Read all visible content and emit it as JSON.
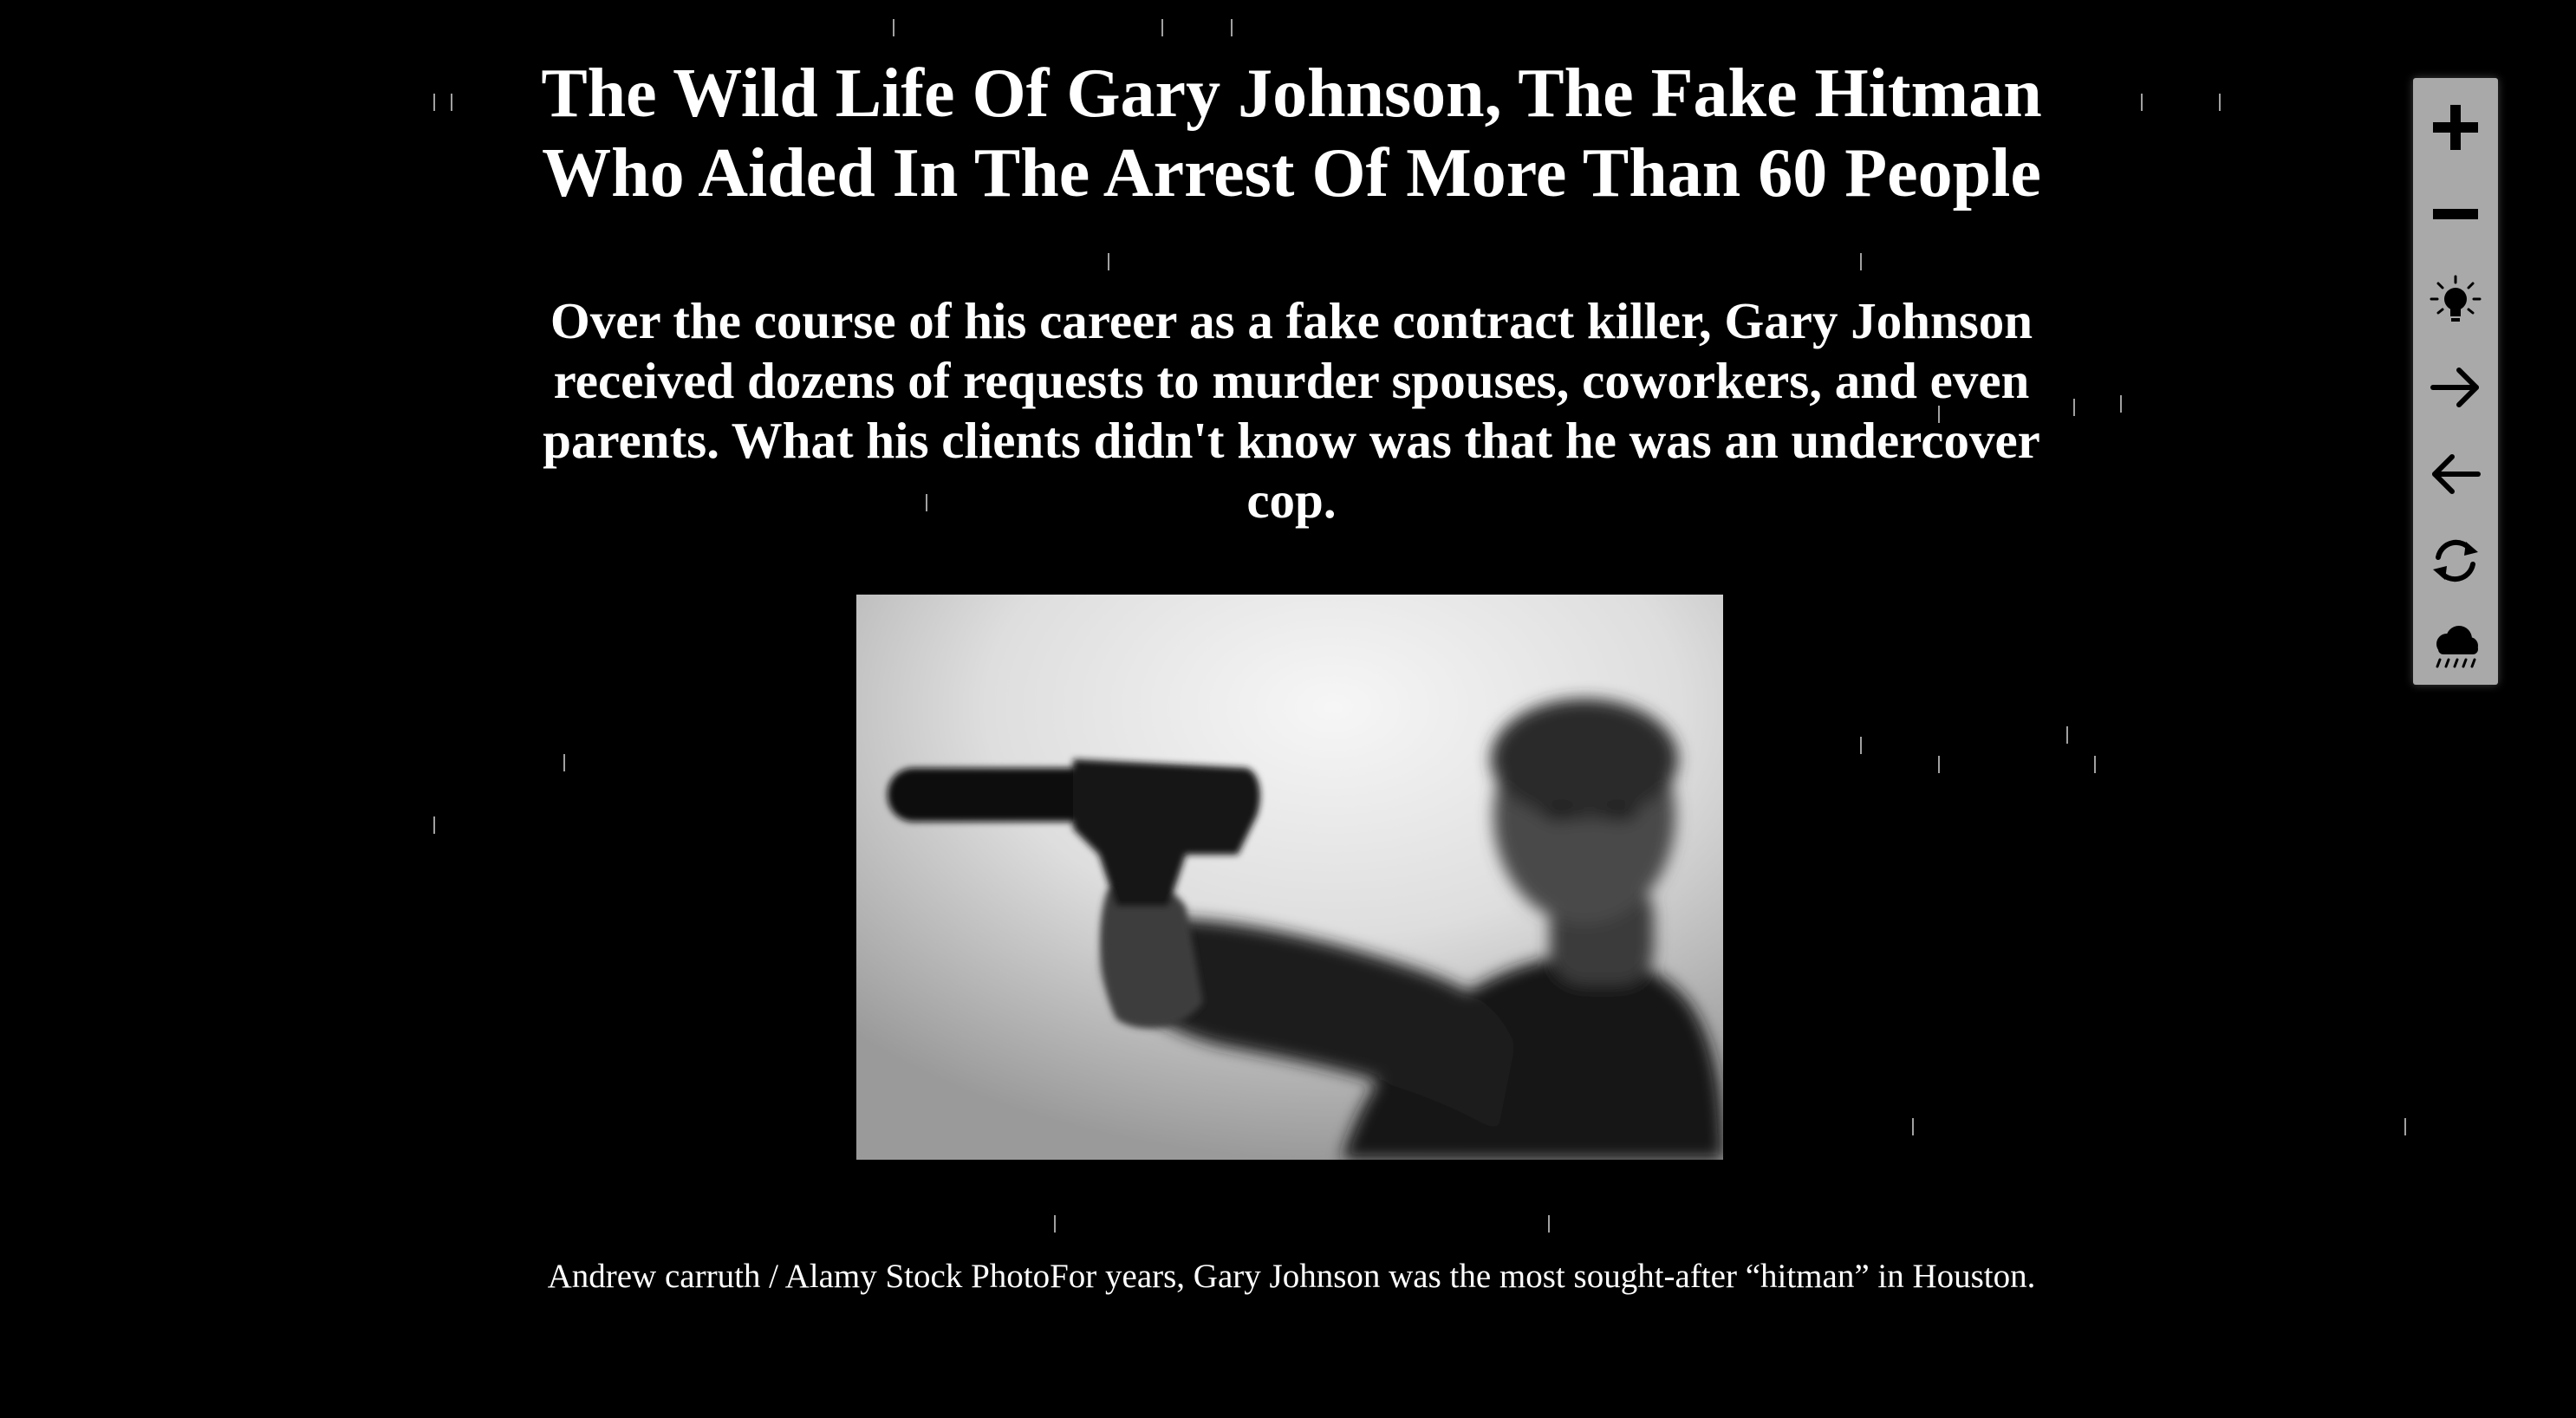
{
  "article": {
    "headline": "The Wild Life Of Gary Johnson, The Fake Hitman Who Aided In The Arrest Of More Than 60 People",
    "dek": "Over the course of his career as a fake contract killer, Gary Johnson received dozens of requests to murder spouses, coworkers, and even parents. What his clients didn't know was that he was an undercover cop.",
    "caption": "Andrew carruth / Alamy Stock PhotoFor years, Gary Johnson was the most sought-after “hitman” in Houston."
  },
  "toolbar": {
    "items": [
      {
        "icon": "plus-icon"
      },
      {
        "icon": "minus-icon"
      },
      {
        "icon": "lightbulb-icon"
      },
      {
        "icon": "arrow-right-icon"
      },
      {
        "icon": "arrow-left-icon"
      },
      {
        "icon": "refresh-icon"
      },
      {
        "icon": "rain-cloud-icon"
      }
    ]
  },
  "colors": {
    "background": "#000000",
    "text": "#ffffff",
    "toolbar": "#a9a9a9",
    "toolbar_icon": "#000000"
  }
}
